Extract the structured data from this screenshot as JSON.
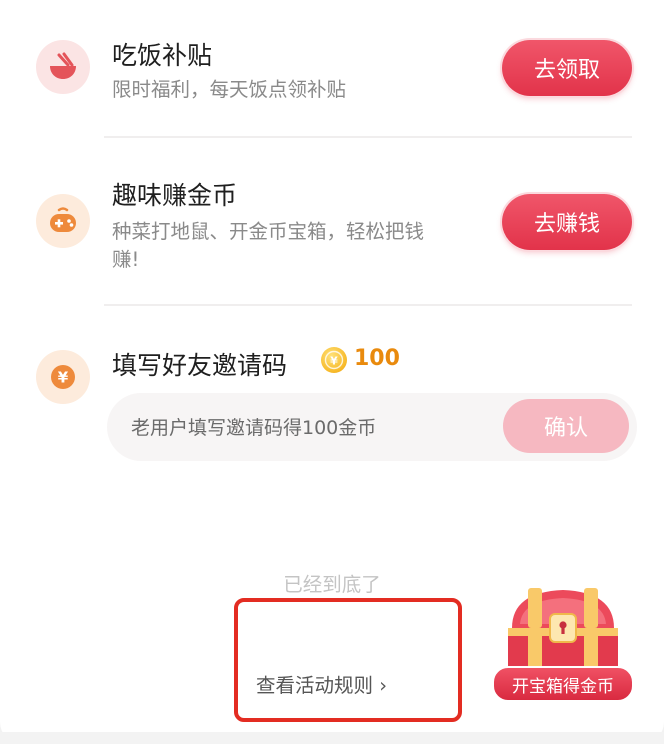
{
  "tasks": [
    {
      "title": "吃饭补贴",
      "subtitle": "限时福利，每天饭点领补贴",
      "button_label": "去领取",
      "icon": "bowl-icon"
    },
    {
      "title": "趣味赚金币",
      "subtitle_line1": "种菜打地鼠、开金币宝箱，轻松把钱",
      "subtitle_line2": "赚!",
      "button_label": "去赚钱",
      "icon": "game-controller-icon"
    },
    {
      "title": "填写好友邀请码",
      "reward_amount": "100",
      "icon": "yen-coin-icon",
      "input_placeholder": "老用户填写邀请码得100金币",
      "confirm_label": "确认"
    }
  ],
  "footer": {
    "end_text": "已经到底了",
    "rules_link": "查看活动规则 ›"
  },
  "treasure": {
    "label": "开宝箱得金币",
    "icon": "treasure-chest-icon"
  },
  "colors": {
    "accent": "#e2334a",
    "accent_disabled": "#f6b8c1",
    "coin": "#e98a0d",
    "highlight_border": "#e32c22"
  }
}
